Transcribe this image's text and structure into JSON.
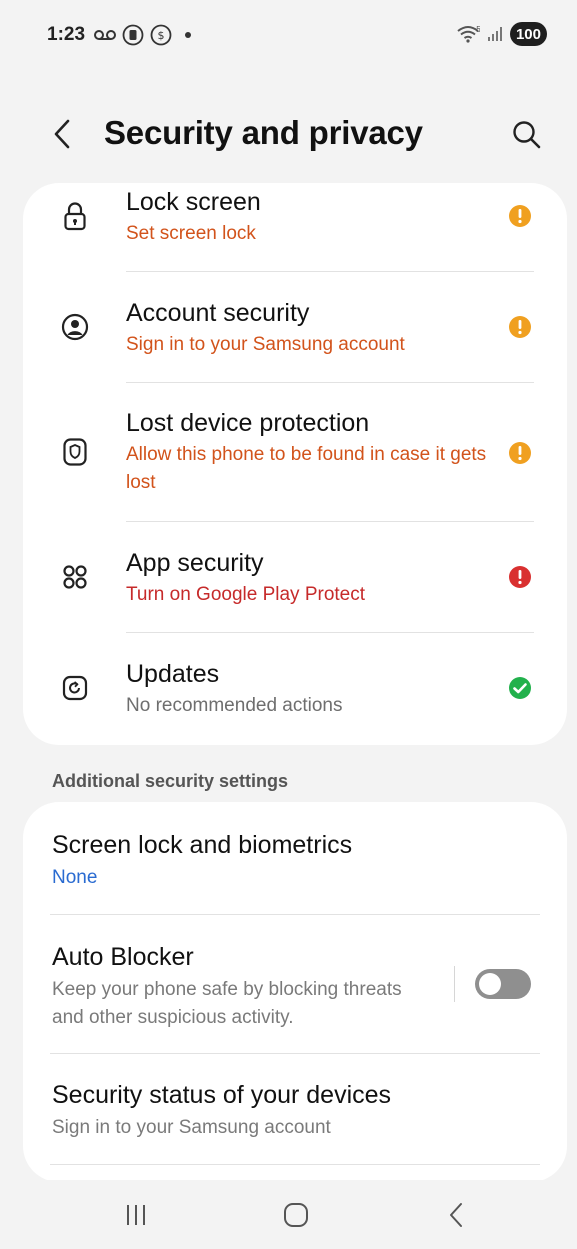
{
  "status_bar": {
    "time": "1:23",
    "battery": "100",
    "icons_left": [
      "voicemail-icon",
      "sim-icon",
      "data-saver-icon",
      "dot-icon"
    ],
    "icons_right": [
      "wifi-icon",
      "signal-icon"
    ]
  },
  "header": {
    "title": "Security and privacy"
  },
  "security_items": [
    {
      "title": "Lock screen",
      "subtitle": "Set screen lock",
      "icon": "lock-icon",
      "status": "warning"
    },
    {
      "title": "Account security",
      "subtitle": "Sign in to your Samsung account",
      "icon": "account-icon",
      "status": "warning"
    },
    {
      "title": "Lost device protection",
      "subtitle": "Allow this phone to be found in case it gets lost",
      "icon": "shield-icon",
      "status": "warning"
    },
    {
      "title": "App security",
      "subtitle": "Turn on Google Play Protect",
      "icon": "apps-icon",
      "status": "error"
    },
    {
      "title": "Updates",
      "subtitle": "No recommended actions",
      "icon": "update-icon",
      "status": "ok"
    }
  ],
  "additional": {
    "header": "Additional security settings",
    "items": [
      {
        "title": "Screen lock and biometrics",
        "subtitle": "None"
      },
      {
        "title": "Auto Blocker",
        "subtitle": "Keep your phone safe by blocking threats and other suspicious activity.",
        "toggle": false
      },
      {
        "title": "Security status of your devices",
        "subtitle": "Sign in to your Samsung account"
      }
    ]
  },
  "colors": {
    "warning": "#f0a020",
    "error": "#d93030",
    "ok": "#22b14c",
    "subtitle_orange": "#d2531b",
    "subtitle_red": "#c62a2a",
    "link_blue": "#2a6bd1"
  }
}
